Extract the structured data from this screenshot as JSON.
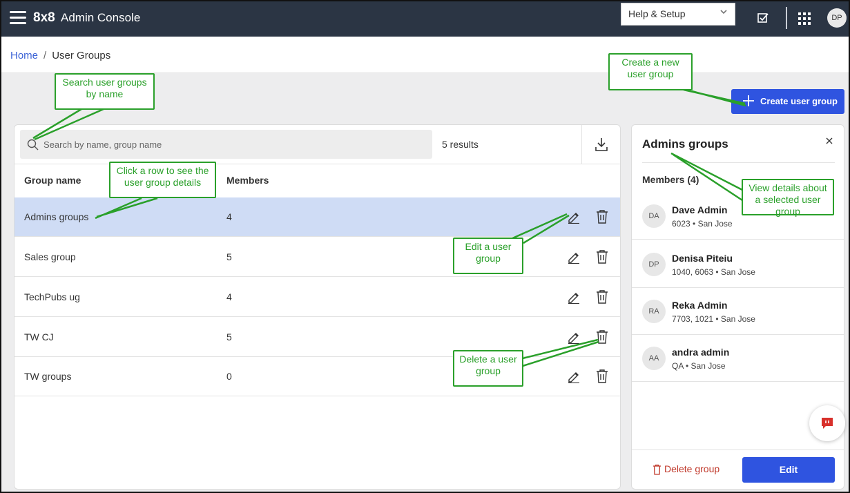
{
  "header": {
    "brand": "8x8",
    "title": "Admin Console",
    "help_select": "Help & Setup",
    "user_initials": "DP"
  },
  "breadcrumb": {
    "home": "Home",
    "separator": "/",
    "current": "User Groups"
  },
  "toolbar": {
    "create_label": "Create user group"
  },
  "search": {
    "placeholder": "Search by name, group name",
    "value": "",
    "results": "5 results"
  },
  "table": {
    "columns": [
      "Group name",
      "Members"
    ],
    "rows": [
      {
        "name": "Admins groups",
        "members": "4"
      },
      {
        "name": "Sales group",
        "members": "5"
      },
      {
        "name": "TechPubs ug",
        "members": "4"
      },
      {
        "name": "TW CJ",
        "members": "5"
      },
      {
        "name": "TW groups",
        "members": "0"
      }
    ]
  },
  "details": {
    "title": "Admins groups",
    "members_heading": "Members (4)",
    "members": [
      {
        "initials": "DA",
        "name": "Dave Admin",
        "sub": "6023 • San Jose"
      },
      {
        "initials": "DP",
        "name": "Denisa Piteiu",
        "sub": "1040, 6063 • San Jose"
      },
      {
        "initials": "RA",
        "name": "Reka Admin",
        "sub": "7703, 1021 • San Jose"
      },
      {
        "initials": "AA",
        "name": "andra admin",
        "sub": "QA • San Jose"
      }
    ],
    "delete_label": "Delete group",
    "edit_label": "Edit"
  },
  "annotations": {
    "search": "Search user groups by name",
    "create": "Create a new user group",
    "row": "Click a row to see the user group details",
    "edit": "Edit a  user group",
    "delete": "Delete a user group",
    "details": "View details about a selected user group"
  },
  "colors": {
    "topbar": "#2b3544",
    "accent": "#2f54e0",
    "selected_row": "#cfdcf5",
    "callout": "#2aa02a",
    "danger": "#c0392b"
  }
}
